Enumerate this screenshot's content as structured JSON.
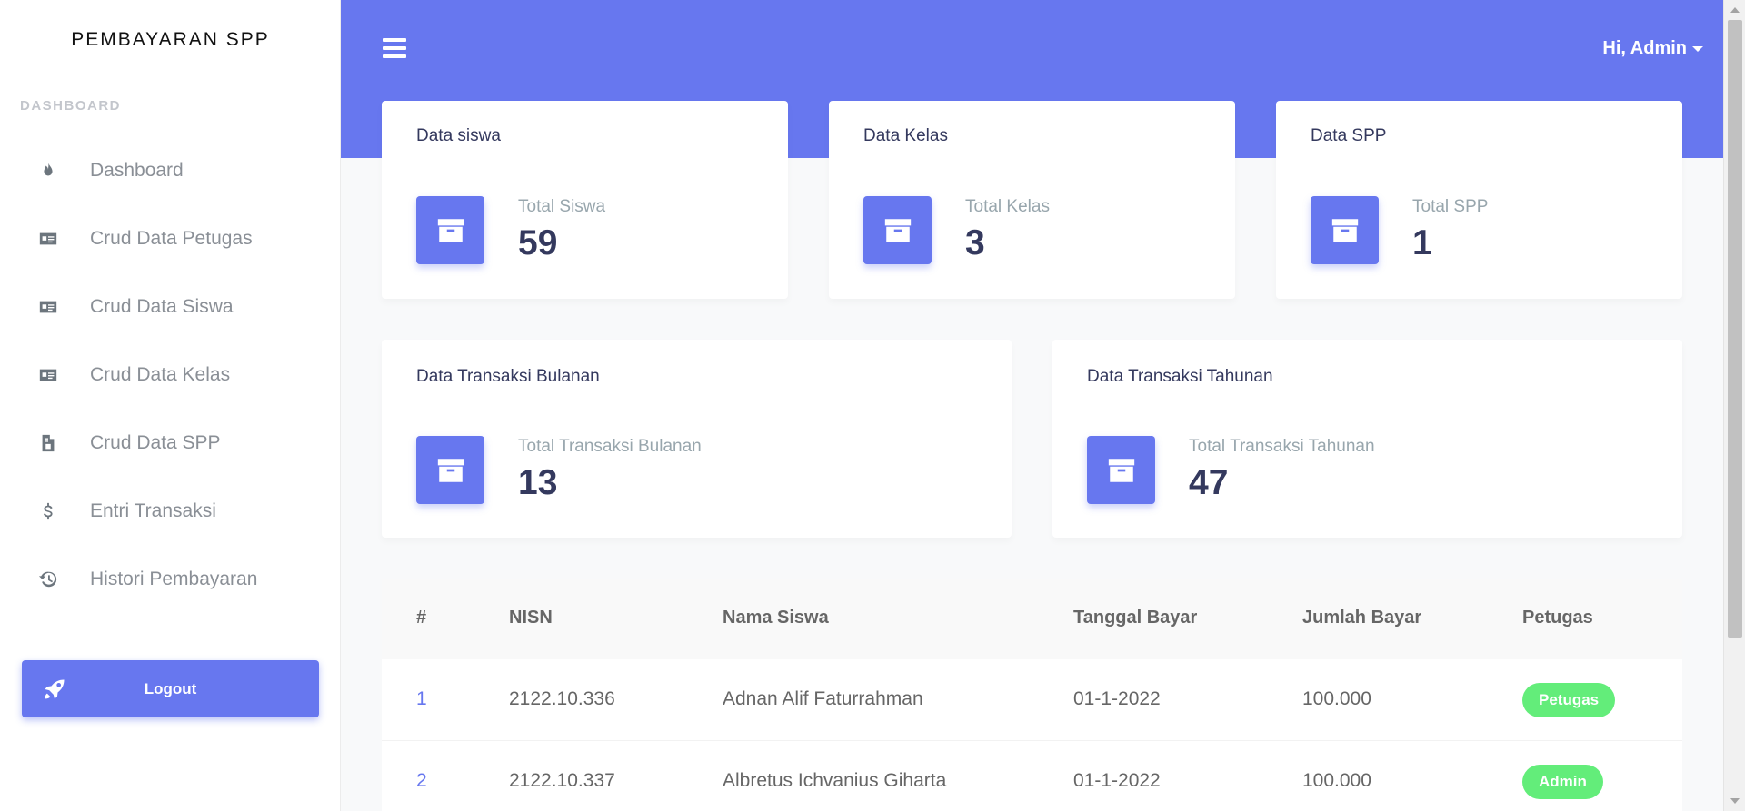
{
  "app": {
    "brand": "PEMBAYARAN SPP"
  },
  "sidebar": {
    "section_label": "DASHBOARD",
    "items": [
      {
        "label": "Dashboard",
        "icon": "fire-icon"
      },
      {
        "label": "Crud Data Petugas",
        "icon": "id-card-icon"
      },
      {
        "label": "Crud Data Siswa",
        "icon": "id-card-icon"
      },
      {
        "label": "Crud Data Kelas",
        "icon": "id-card-icon"
      },
      {
        "label": "Crud Data SPP",
        "icon": "file-invoice-icon"
      },
      {
        "label": "Entri Transaksi",
        "icon": "dollar-icon"
      },
      {
        "label": "Histori Pembayaran",
        "icon": "history-icon"
      }
    ],
    "logout_label": "Logout"
  },
  "header": {
    "user_greeting": "Hi, Admin"
  },
  "stats": [
    {
      "title": "Data siswa",
      "label": "Total Siswa",
      "value": "59"
    },
    {
      "title": "Data Kelas",
      "label": "Total Kelas",
      "value": "3"
    },
    {
      "title": "Data SPP",
      "label": "Total SPP",
      "value": "1"
    },
    {
      "title": "Data Transaksi Bulanan",
      "label": "Total Transaksi Bulanan",
      "value": "13"
    },
    {
      "title": "Data Transaksi Tahunan",
      "label": "Total Transaksi Tahunan",
      "value": "47"
    }
  ],
  "table": {
    "headers": [
      "#",
      "NISN",
      "Nama Siswa",
      "Tanggal Bayar",
      "Jumlah Bayar",
      "Petugas"
    ],
    "rows": [
      [
        "1",
        "2122.10.336",
        "Adnan Alif Faturrahman",
        "01-1-2022",
        "100.000",
        "Petugas"
      ],
      [
        "2",
        "2122.10.337",
        "Albretus Ichvanius Giharta",
        "01-1-2022",
        "100.000",
        "Admin"
      ]
    ]
  },
  "colors": {
    "accent": "#6777ef",
    "badge": "#63ed7a"
  }
}
